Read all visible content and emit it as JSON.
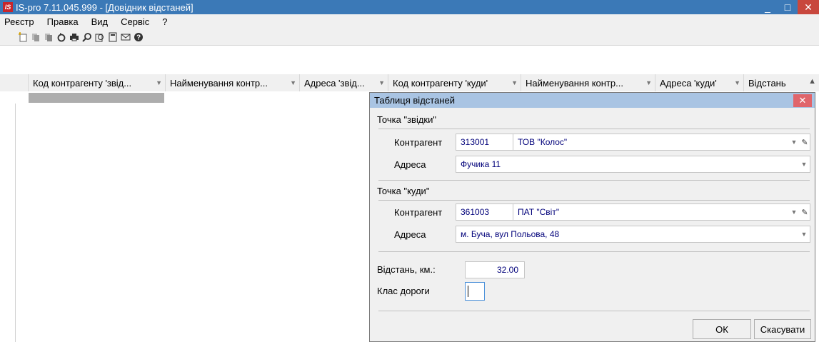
{
  "window": {
    "logo_text": "IS",
    "title": "IS-pro 7.11.045.999 - [Довідник відстаней]",
    "min_label": "_",
    "max_label": "□",
    "close_label": "✕"
  },
  "menu": {
    "items": [
      "Реєстр",
      "Правка",
      "Вид",
      "Сервіс",
      "?"
    ]
  },
  "toolbar": {
    "icons": [
      "new-icon",
      "copy-icon",
      "paste-icon",
      "refresh-icon",
      "print-icon",
      "find-icon",
      "export-icon",
      "calc-icon",
      "mail-icon",
      "help-icon"
    ]
  },
  "grid": {
    "columns": [
      "Код контрагенту 'звід...",
      "Найменування контр...",
      "Адреса 'звід...",
      "Код контрагенту 'куди'",
      "Найменування контр...",
      "Адреса 'куди'",
      "Відстань"
    ]
  },
  "dialog": {
    "title": "Таблиця відстаней",
    "close_label": "✕",
    "from_section": "Точка \"звідки\"",
    "to_section": "Точка \"куди\"",
    "counterparty_label": "Контрагент",
    "address_label": "Адреса",
    "from_counterparty_code": "313001",
    "from_counterparty_name": "ТОВ \"Колос\"",
    "from_address": "Фучика 11",
    "to_counterparty_code": "361003",
    "to_counterparty_name": "ПАТ \"Світ\"",
    "to_address": "м. Буча, вул Польова, 48",
    "distance_label": "Відстань, км.:",
    "distance_value": "32.00",
    "road_class_label": "Клас дороги",
    "road_class_value": "",
    "ok_label": "ОК",
    "cancel_label": "Скасувати"
  },
  "colors": {
    "titlebar": "#3b79b7",
    "dialog_title": "#a9c4e3",
    "field_text": "#00007a"
  }
}
